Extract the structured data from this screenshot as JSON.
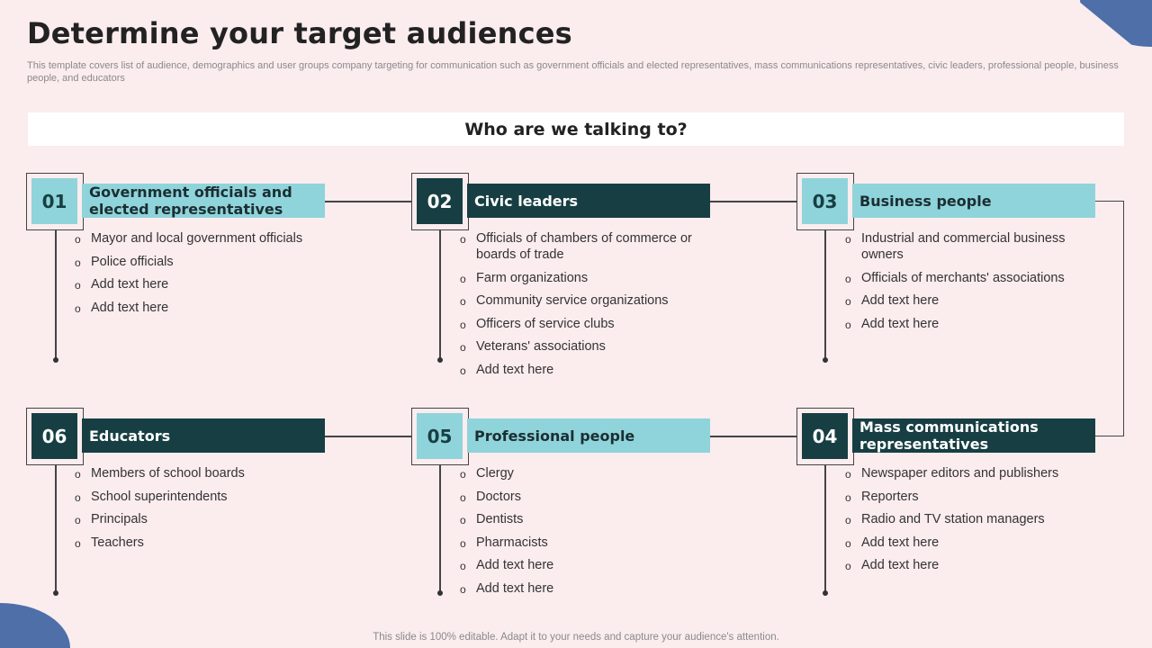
{
  "title": "Determine your target audiences",
  "subtitle": "This template covers list of audience, demographics and user groups company targeting for communication such as government officials and elected representatives, mass communications representatives, civic leaders, professional people, business people, and educators",
  "banner": "Who are we talking to?",
  "cards": {
    "c01": {
      "number": "01",
      "heading": "Government officials  and elected representatives",
      "items": [
        "Mayor and local government officials",
        "Police officials",
        "Add text here",
        "Add text here"
      ]
    },
    "c02": {
      "number": "02",
      "heading": "Civic leaders",
      "items": [
        "Officials of chambers of commerce or boards of trade",
        "Farm organizations",
        "Community service organizations",
        "Officers of service clubs",
        "Veterans' associations",
        "Add text here"
      ]
    },
    "c03": {
      "number": "03",
      "heading": "Business  people",
      "items": [
        "Industrial and commercial business owners",
        "Officials of merchants' associations",
        "Add text here",
        "Add text here"
      ]
    },
    "c04": {
      "number": "04",
      "heading": "Mass communications representatives",
      "items": [
        "Newspaper editors and publishers",
        "Reporters",
        "Radio and TV station managers",
        "Add text here",
        "Add text here"
      ]
    },
    "c05": {
      "number": "05",
      "heading": "Professional  people",
      "items": [
        "Clergy",
        "Doctors",
        "Dentists",
        "Pharmacists",
        "Add text here",
        "Add text here"
      ]
    },
    "c06": {
      "number": "06",
      "heading": "Educators",
      "items": [
        "Members of school boards",
        "School superintendents",
        "Principals",
        "Teachers"
      ]
    }
  },
  "footer": "This slide is 100% editable. Adapt it to your needs and capture your audience's attention.",
  "colors": {
    "background": "#fbecee",
    "light_teal": "#8fd4da",
    "dark_teal": "#173f43",
    "accent_blue": "#4e6fa8"
  }
}
